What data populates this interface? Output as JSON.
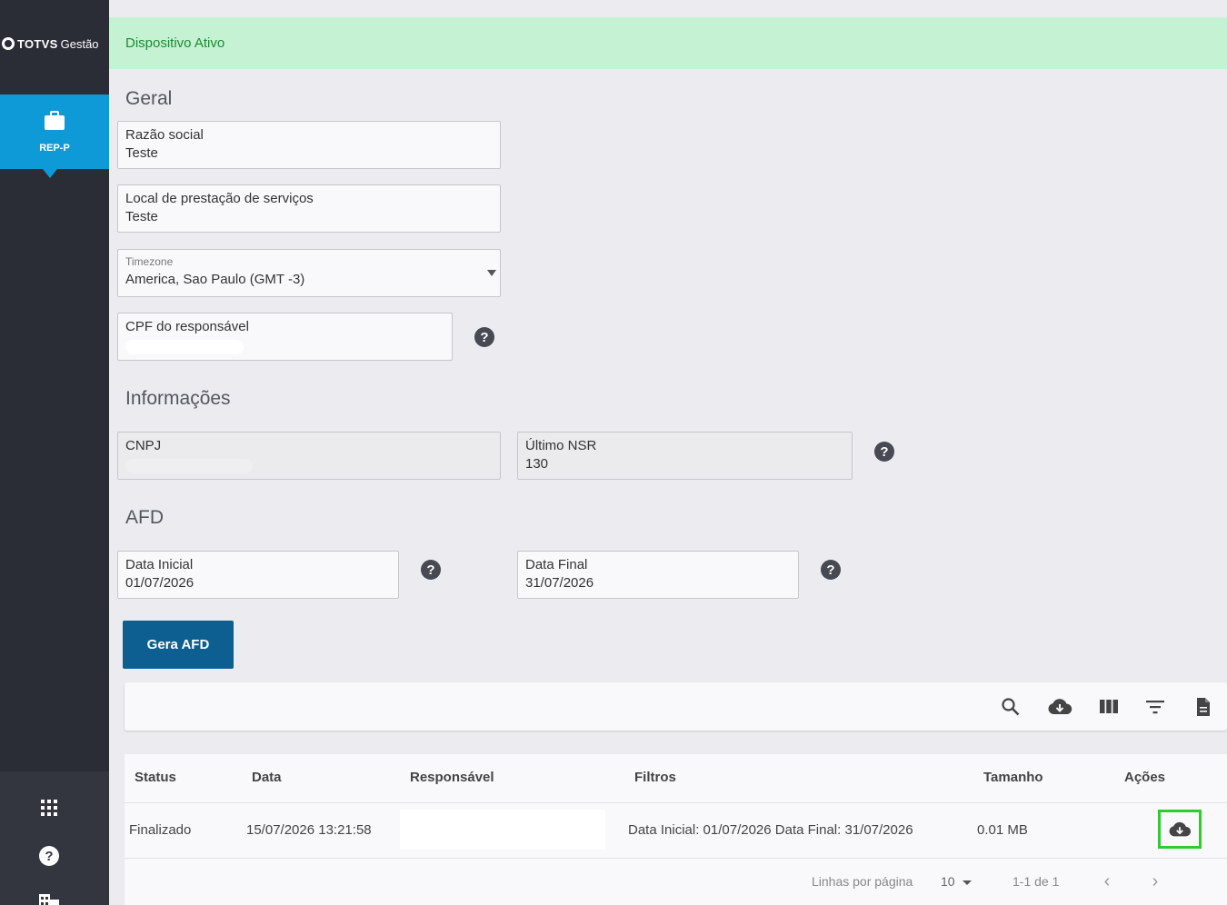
{
  "app": {
    "brand": "TOTVS",
    "product": "Gestão"
  },
  "sidebar": {
    "active_item": {
      "label": "REP-P",
      "icon": "briefcase-icon"
    },
    "bottom_icons": [
      "apps-grid-icon",
      "help-icon",
      "building-icon"
    ]
  },
  "banner": {
    "text": "Dispositivo Ativo"
  },
  "sections": {
    "geral": "Geral",
    "informacoes": "Informações",
    "afd": "AFD"
  },
  "geral": {
    "razao_social": {
      "label": "Razão social",
      "value": "Teste"
    },
    "local": {
      "label": "Local de prestação de serviços",
      "value": "Teste"
    },
    "timezone": {
      "label": "Timezone",
      "value": "America, Sao Paulo (GMT -3)"
    },
    "cpf": {
      "label": "CPF do responsável",
      "value": ""
    }
  },
  "informacoes": {
    "cnpj": {
      "label": "CNPJ",
      "value": ""
    },
    "ultimo_nsr": {
      "label": "Último NSR",
      "value": "130"
    }
  },
  "afd": {
    "data_inicial": {
      "label": "Data Inicial",
      "value": "01/07/2026"
    },
    "data_final": {
      "label": "Data Final",
      "value": "31/07/2026"
    },
    "button": "Gera AFD"
  },
  "toolbar": {
    "icons": [
      "search-icon",
      "cloud-download-icon",
      "columns-icon",
      "filter-icon",
      "document-icon"
    ]
  },
  "table": {
    "headers": {
      "status": "Status",
      "data": "Data",
      "responsavel": "Responsável",
      "filtros": "Filtros",
      "tamanho": "Tamanho",
      "acoes": "Ações"
    },
    "rows": [
      {
        "status": "Finalizado",
        "data": "15/07/2026 13:21:58",
        "responsavel": "",
        "filtros": "Data Inicial: 01/07/2026 Data Final: 31/07/2026",
        "tamanho": "0.01 MB"
      }
    ],
    "footer": {
      "rows_per_page_label": "Linhas por página",
      "rows_per_page": "10",
      "range": "1-1 de 1"
    }
  },
  "colors": {
    "sidebar": "#2b2d36",
    "accent": "#0e9ad7",
    "button": "#0d5f91",
    "banner_bg": "#c5f2d2",
    "banner_text": "#1f8a33",
    "highlight": "#2ecc2e"
  }
}
